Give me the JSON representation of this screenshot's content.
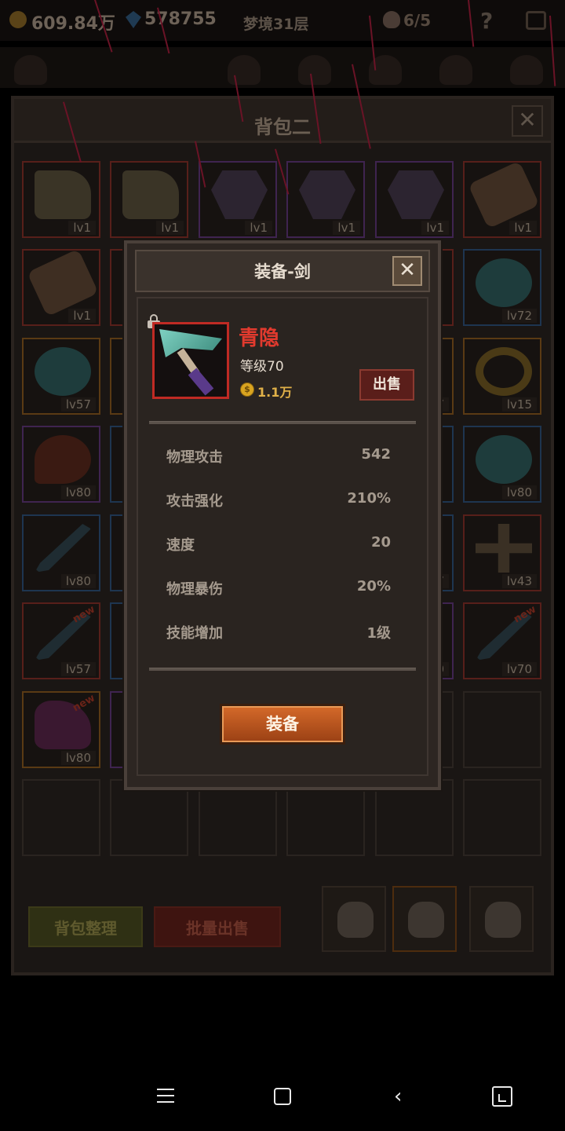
{
  "hud": {
    "gold": "609.84万",
    "gems": "578755",
    "floor": "梦境31层",
    "stamina": "6/5"
  },
  "bag": {
    "title": "背包二",
    "close_glyph": "✕",
    "rows": [
      [
        {
          "lv": "lv1",
          "art": "boot",
          "rarity": "red"
        },
        {
          "lv": "lv1",
          "art": "boot",
          "rarity": "red"
        },
        {
          "lv": "lv1",
          "art": "armor",
          "rarity": "purple"
        },
        {
          "lv": "lv1",
          "art": "armor",
          "rarity": "purple"
        },
        {
          "lv": "lv1",
          "art": "armor",
          "rarity": "purple"
        },
        {
          "lv": "lv1",
          "art": "shield",
          "rarity": "red"
        }
      ],
      [
        {
          "lv": "lv1",
          "art": "shield",
          "rarity": "red"
        },
        {
          "lv": "",
          "art": "",
          "rarity": "red"
        },
        {
          "lv": "",
          "art": "",
          "rarity": "red"
        },
        {
          "lv": "",
          "art": "",
          "rarity": "red"
        },
        {
          "lv": "",
          "art": "",
          "rarity": "red"
        },
        {
          "lv": "lv72",
          "art": "orb",
          "rarity": "blue"
        }
      ],
      [
        {
          "lv": "lv57",
          "art": "orb",
          "rarity": "orange"
        },
        {
          "lv": "",
          "art": "",
          "rarity": "orange"
        },
        {
          "lv": "",
          "art": "",
          "rarity": "orange"
        },
        {
          "lv": "",
          "art": "",
          "rarity": "orange"
        },
        {
          "lv": "7",
          "art": "",
          "rarity": "orange"
        },
        {
          "lv": "lv15",
          "art": "ring",
          "rarity": "orange"
        }
      ],
      [
        {
          "lv": "lv80",
          "art": "mace",
          "rarity": "purple"
        },
        {
          "lv": "",
          "art": "",
          "rarity": "blue"
        },
        {
          "lv": "",
          "art": "",
          "rarity": "blue"
        },
        {
          "lv": "",
          "art": "",
          "rarity": "blue"
        },
        {
          "lv": "",
          "art": "",
          "rarity": "blue"
        },
        {
          "lv": "lv80",
          "art": "orb",
          "rarity": "blue"
        }
      ],
      [
        {
          "lv": "lv80",
          "art": "sword",
          "rarity": "blue"
        },
        {
          "lv": "",
          "art": "",
          "rarity": "blue"
        },
        {
          "lv": "",
          "art": "",
          "rarity": "blue"
        },
        {
          "lv": "",
          "art": "",
          "rarity": "blue"
        },
        {
          "lv": "7",
          "art": "",
          "rarity": "blue"
        },
        {
          "lv": "lv43",
          "art": "cross",
          "rarity": "red"
        }
      ],
      [
        {
          "lv": "lv57",
          "art": "sword",
          "rarity": "red",
          "new": "new"
        },
        {
          "lv": "",
          "art": "",
          "rarity": "blue"
        },
        {
          "lv": "",
          "art": "",
          "rarity": "blue"
        },
        {
          "lv": "",
          "art": "",
          "rarity": "blue"
        },
        {
          "lv": "0",
          "art": "",
          "rarity": "purple"
        },
        {
          "lv": "lv70",
          "art": "sword",
          "rarity": "red",
          "new": "new"
        }
      ],
      [
        {
          "lv": "lv80",
          "art": "glove",
          "rarity": "orange",
          "new": "new"
        },
        {
          "lv": "",
          "art": "",
          "rarity": "purple"
        },
        {
          "lv": "",
          "art": "",
          "rarity": "empty"
        },
        {
          "lv": "",
          "art": "",
          "rarity": "empty"
        },
        {
          "lv": "",
          "art": "",
          "rarity": "empty"
        },
        {
          "lv": "",
          "art": "",
          "rarity": "empty"
        }
      ],
      [
        {
          "lv": "",
          "art": "",
          "rarity": "empty"
        },
        {
          "lv": "",
          "art": "",
          "rarity": "empty"
        },
        {
          "lv": "",
          "art": "",
          "rarity": "empty"
        },
        {
          "lv": "",
          "art": "",
          "rarity": "empty"
        },
        {
          "lv": "",
          "art": "",
          "rarity": "empty"
        },
        {
          "lv": "",
          "art": "",
          "rarity": "empty"
        }
      ]
    ],
    "sort_label": "背包整理",
    "bulk_sell_label": "批量出售"
  },
  "modal": {
    "title": "装备-剑",
    "close_glyph": "✕",
    "item": {
      "name": "青隐",
      "level": "等级70",
      "coin_glyph": "$",
      "price": "1.1万"
    },
    "sell_label": "出售",
    "stats": [
      {
        "label": "物理攻击",
        "value": "542"
      },
      {
        "label": "攻击强化",
        "value": "210%"
      },
      {
        "label": "速度",
        "value": "20"
      },
      {
        "label": "物理暴伤",
        "value": "20%"
      },
      {
        "label": "技能增加",
        "value": "1级"
      }
    ],
    "equip_label": "装备"
  },
  "colors": {
    "rarity_red": "#c02a24",
    "item_name": "#e23a2e",
    "equip_button": "#c35a20",
    "price_gold": "#e0b048"
  },
  "icons": [
    "lock-icon",
    "coin-icon",
    "close-icon",
    "help-icon",
    "skull-icon",
    "gold-icon",
    "gem-icon"
  ]
}
